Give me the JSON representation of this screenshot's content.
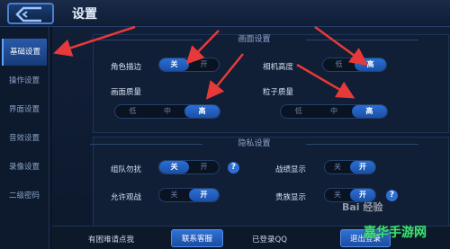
{
  "header": {
    "title": "设置"
  },
  "sidebar": {
    "items": [
      {
        "label": "基础设置",
        "active": true
      },
      {
        "label": "操作设置"
      },
      {
        "label": "界面设置"
      },
      {
        "label": "音效设置"
      },
      {
        "label": "录像设置"
      },
      {
        "label": "二级密码"
      }
    ]
  },
  "display_section": {
    "title": "画面设置",
    "outline": {
      "label": "角色描边",
      "options": [
        "关",
        "开"
      ],
      "selected": "关"
    },
    "camera_height": {
      "label": "相机高度",
      "options": [
        "低",
        "高"
      ],
      "selected": "高"
    },
    "quality": {
      "label": "画面质量",
      "options": [
        "低",
        "中",
        "高"
      ],
      "selected": "高"
    },
    "particles": {
      "label": "粒子质量",
      "options": [
        "低",
        "中",
        "高"
      ],
      "selected": "高"
    }
  },
  "privacy_section": {
    "title": "隐私设置",
    "team_no_disturb": {
      "label": "组队勿扰",
      "options": [
        "关",
        "开"
      ],
      "selected": "关",
      "help": "?"
    },
    "battle_display": {
      "label": "战绩显示",
      "options": [
        "关",
        "开"
      ],
      "selected": "开"
    },
    "allow_spectate": {
      "label": "允许观战",
      "options": [
        "关",
        "开"
      ],
      "selected": "开"
    },
    "noble_display": {
      "label": "贵族显示",
      "options": [
        "关",
        "开"
      ],
      "selected": "开",
      "help": "?"
    }
  },
  "footer": {
    "problem_text": "有困难请点我",
    "contact_button": "联系客服",
    "login_status": "已登录QQ",
    "logout_button": "退出登录"
  },
  "watermark": {
    "paw_text": "Bai 经验",
    "site_text": "嘉华手游网"
  },
  "colors": {
    "accent": "#2a6fd6",
    "background": "#0b1526",
    "arrow": "#e63a3a",
    "watermark_site": "#3fe07a"
  },
  "icons": {
    "back": "back-arrow-icon",
    "help": "help-icon"
  }
}
